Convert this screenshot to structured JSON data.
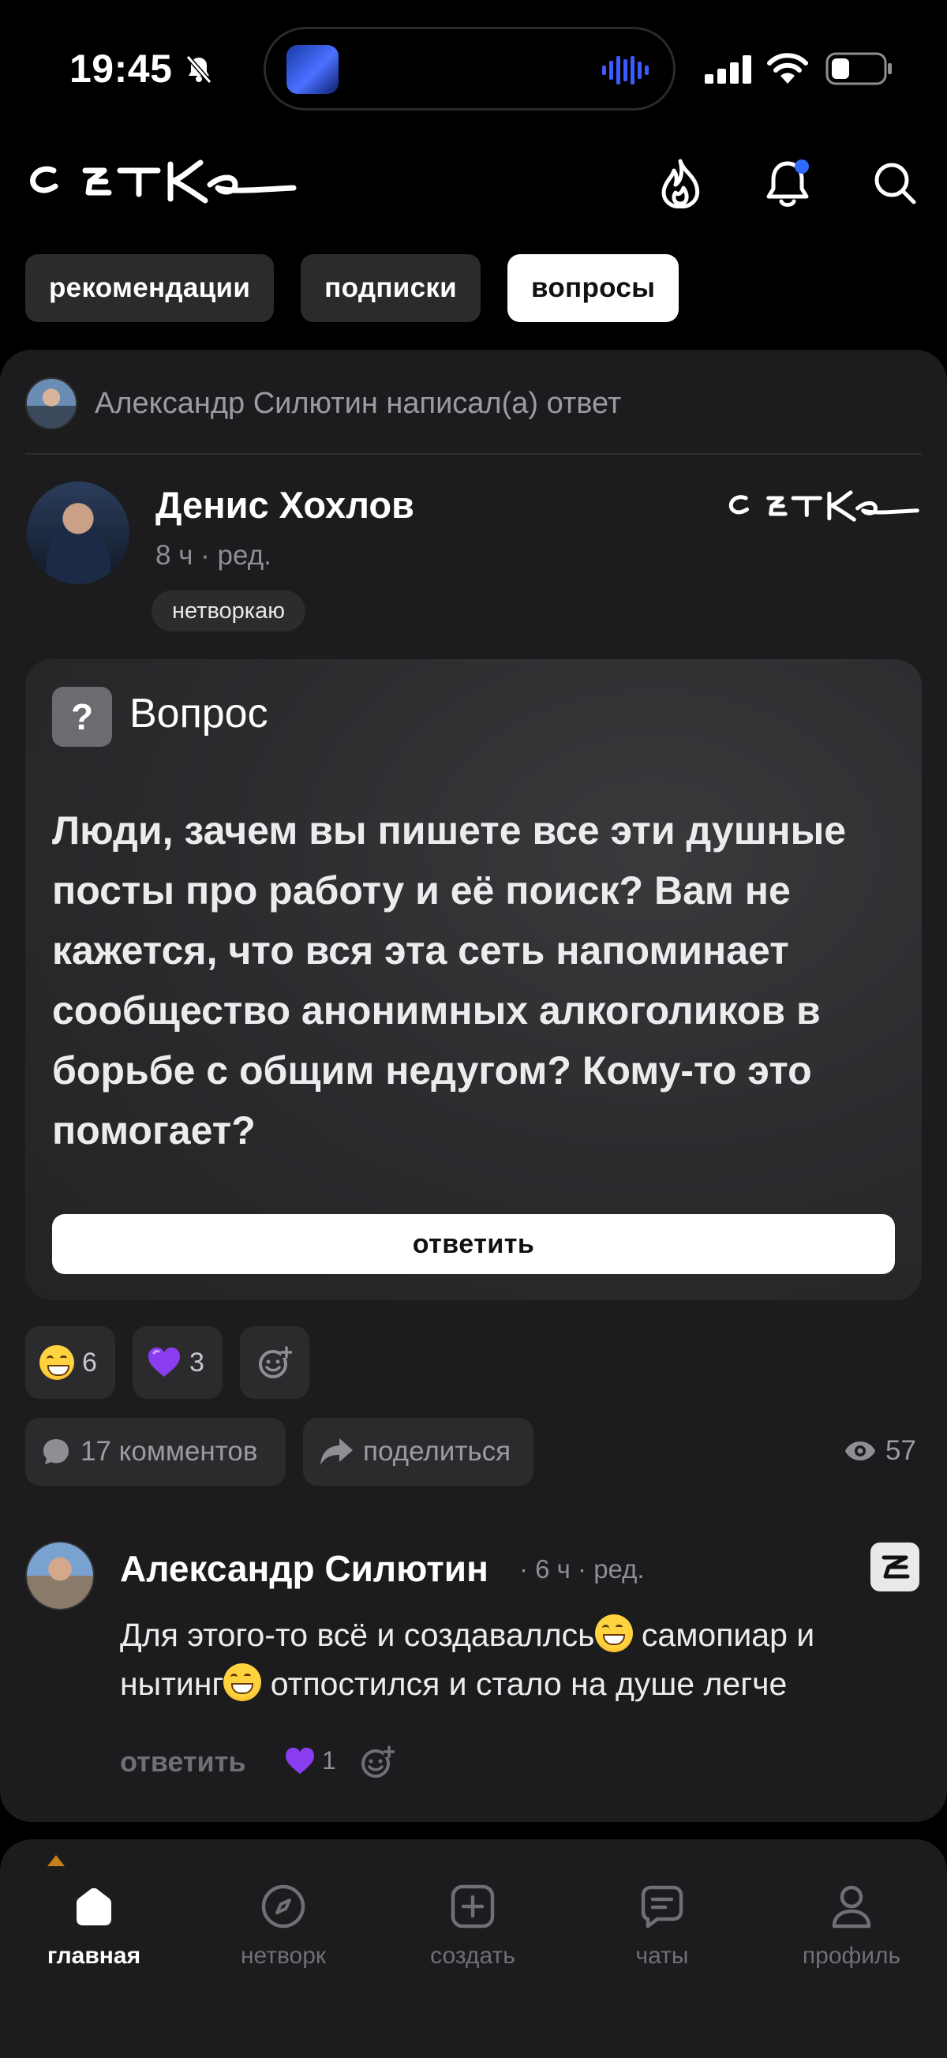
{
  "status_bar": {
    "time": "19:45",
    "icons": [
      "bell-slash-icon",
      "signal-icon",
      "wifi-icon",
      "battery-icon"
    ]
  },
  "header": {
    "logo_text": "сетка",
    "icons": [
      "flame-icon",
      "bell-icon",
      "search-icon"
    ],
    "notification_dot_color": "#2f6bff"
  },
  "tabs": [
    {
      "label": "рекомендации",
      "active": false
    },
    {
      "label": "подписки",
      "active": false
    },
    {
      "label": "вопросы",
      "active": true
    }
  ],
  "post": {
    "activity": "Александр Силютин написал(а) ответ",
    "author": {
      "name": "Денис Хохлов",
      "meta": "8 ч · ред.",
      "tag": "нетворкаю"
    },
    "question": {
      "badge": "?",
      "label": "Вопрос",
      "text": "Люди, зачем вы пишете все эти душные посты про работу и её поиск? Вам не кажется, что вся эта сеть напоминает сообщество анонимных алкоголиков в борьбе с общим недугом? Кому-то это помогает?",
      "answer_button": "ответить"
    },
    "reactions": [
      {
        "emoji": "grinning-face-icon",
        "count": "6"
      },
      {
        "emoji": "purple-heart-icon",
        "count": "3"
      }
    ],
    "comments_label": "17 комментов",
    "share_label": "поделиться",
    "views": "57"
  },
  "comment": {
    "author": "Александр Силютин",
    "meta": "· 6 ч · ред.",
    "text_part1": "Для этого-то всё и создаваллсь",
    "text_part2": " самопиар и нытинг",
    "text_part3": " отпостился и стало на душе легче",
    "reply_label": "ответить",
    "heart_count": "1"
  },
  "bottom_nav": [
    {
      "label": "главная",
      "icon": "home-icon",
      "active": true
    },
    {
      "label": "нетворк",
      "icon": "compass-icon",
      "active": false
    },
    {
      "label": "создать",
      "icon": "plus-square-icon",
      "active": false
    },
    {
      "label": "чаты",
      "icon": "chat-icon",
      "active": false
    },
    {
      "label": "профиль",
      "icon": "profile-icon",
      "active": false
    }
  ],
  "colors": {
    "background": "#000000",
    "card": "#1c1c1e",
    "chip": "#2b2b2e",
    "heart": "#8a3df0"
  }
}
